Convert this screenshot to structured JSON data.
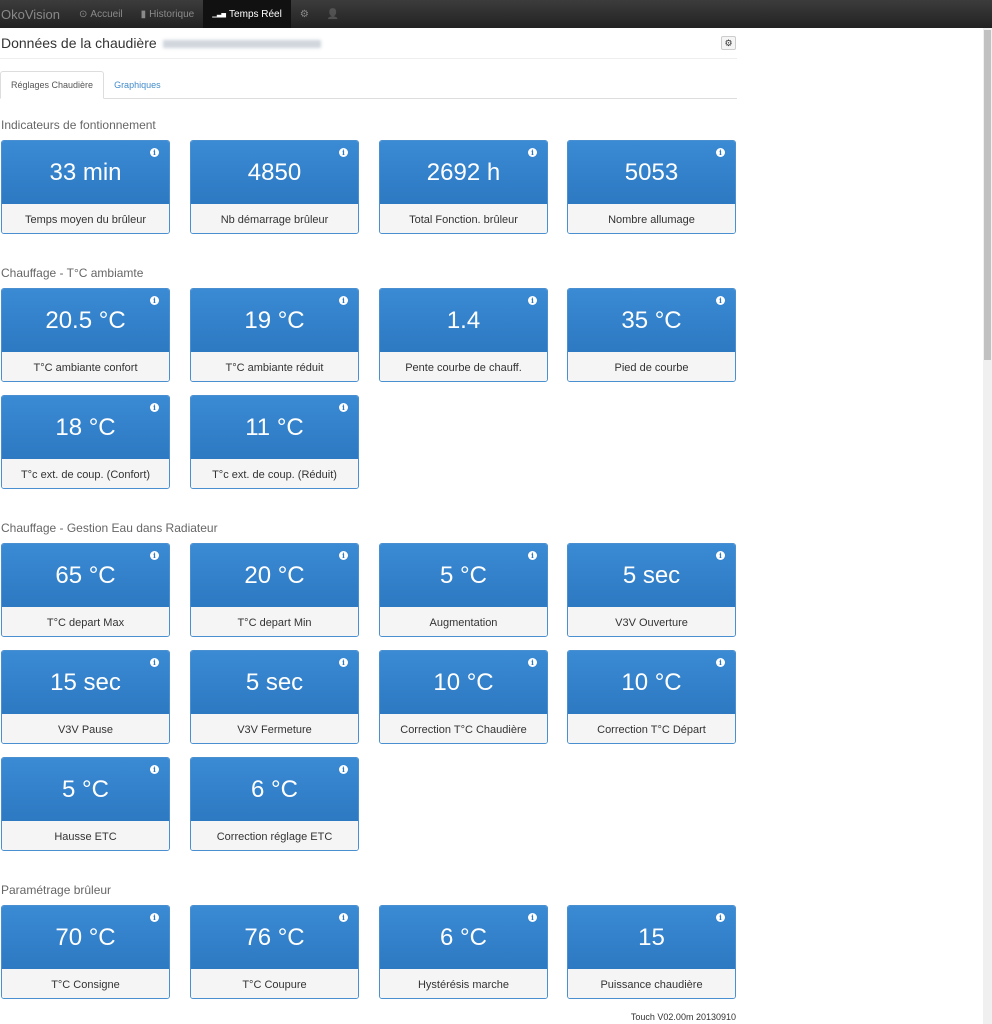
{
  "nav": {
    "brand": "OkoVision",
    "items": [
      {
        "label": "Accueil",
        "icon": "⊙"
      },
      {
        "label": "Historique",
        "icon": "▮"
      },
      {
        "label": "Temps Réel",
        "icon": "▁▃▅"
      }
    ],
    "settings_icon": "⚙",
    "user_icon": "👤"
  },
  "header": {
    "title": "Données de la chaudière"
  },
  "tabs": [
    "Réglages Chaudière",
    "Graphiques"
  ],
  "sections": [
    {
      "title": "Indicateurs de fontionnement",
      "cards": [
        {
          "value": "33 min",
          "label": "Temps moyen du brûleur"
        },
        {
          "value": "4850",
          "label": "Nb démarrage brûleur"
        },
        {
          "value": "2692 h",
          "label": "Total Fonction. brûleur"
        },
        {
          "value": "5053",
          "label": "Nombre allumage"
        }
      ]
    },
    {
      "title": "Chauffage - T°C ambiamte",
      "cards": [
        {
          "value": "20.5 °C",
          "label": "T°C ambiante confort"
        },
        {
          "value": "19 °C",
          "label": "T°C ambiante réduit"
        },
        {
          "value": "1.4",
          "label": "Pente courbe de chauff."
        },
        {
          "value": "35 °C",
          "label": "Pied de courbe"
        },
        {
          "value": "18 °C",
          "label": "T°c ext. de coup. (Confort)"
        },
        {
          "value": "11 °C",
          "label": "T°c ext. de coup. (Réduit)"
        }
      ]
    },
    {
      "title": "Chauffage - Gestion Eau dans Radiateur",
      "cards": [
        {
          "value": "65 °C",
          "label": "T°C depart Max"
        },
        {
          "value": "20 °C",
          "label": "T°C depart Min"
        },
        {
          "value": "5 °C",
          "label": "Augmentation"
        },
        {
          "value": "5 sec",
          "label": "V3V Ouverture"
        },
        {
          "value": "15 sec",
          "label": "V3V Pause"
        },
        {
          "value": "5 sec",
          "label": "V3V Fermeture"
        },
        {
          "value": "10 °C",
          "label": "Correction T°C Chaudière"
        },
        {
          "value": "10 °C",
          "label": "Correction T°C Départ"
        },
        {
          "value": "5 °C",
          "label": "Hausse ETC"
        },
        {
          "value": "6 °C",
          "label": "Correction réglage ETC"
        }
      ]
    },
    {
      "title": "Paramétrage brûleur",
      "cards": [
        {
          "value": "70 °C",
          "label": "T°C Consigne"
        },
        {
          "value": "76 °C",
          "label": "T°C Coupure"
        },
        {
          "value": "6 °C",
          "label": "Hystérésis marche"
        },
        {
          "value": "15",
          "label": "Puissance chaudière"
        }
      ]
    }
  ],
  "info_glyph": "i",
  "footer": "Touch V02.00m 20130910"
}
